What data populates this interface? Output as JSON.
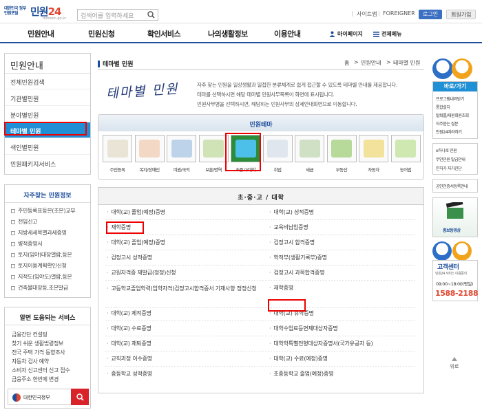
{
  "header": {
    "emblem_text": "대한민국 정부민원포털",
    "logo_main": "민원",
    "logo_num": "24",
    "logo_sub": "minwon.go.kr",
    "search_placeholder": "검색어를 입력하세요",
    "util_links": [
      "사이트맵",
      "FOREIGNER"
    ],
    "login_label": "로그인",
    "join_label": "회원가입"
  },
  "gnb": {
    "items": [
      "민원안내",
      "민원신청",
      "확인서비스",
      "나의생활정보",
      "이용안내"
    ],
    "mypage": "마이페이지",
    "all_menu": "전체메뉴"
  },
  "sidebar": {
    "title": "민원안내",
    "items": [
      "전체민원검색",
      "기관별민원",
      "분야별민원",
      "테마별 민원",
      "색인별민원",
      "민원패키지서비스"
    ],
    "active_index": 3
  },
  "frequent": {
    "title": "자주찾는 민원정보",
    "items": [
      "주민등록표등본(초본)교부",
      "전입신고",
      "지방세세목별과세증명",
      "병적증명서",
      "토지(임야)대장열람,등본",
      "토지이용계획확인신청",
      "지적도(임야도)열람,등본",
      "건축물대장등,초본발급"
    ]
  },
  "helpful": {
    "title": "알면 도움되는 서비스",
    "items": [
      "금융간단 컨설팅",
      "찾기 쉬운 생활법령정보",
      "전국 주택 가격 동향조사",
      "자동차 검사 예약",
      "소비자 신고센터 신고 접수",
      "금융주소 한번에 변경"
    ],
    "gov_label": "대한민국정부"
  },
  "main": {
    "page_title": "테마별 민원",
    "breadcrumb": [
      "홈",
      "민원안내",
      "테마별 민원"
    ],
    "calligraphy": "테마별 민원",
    "intro": [
      "자주 찾는 민원을 일상생활과 밀접한 분류체계로 쉽게 접근할 수 있도록 테마별 안내를 제공합니다.",
      "테마를 선택하시면 해당 테마별 민원사무목록이 화면에 표시됩니다.",
      "민원사무명을 선택하시면, 해당하는 민원사무의 상세안내화면으로 이동합니다."
    ]
  },
  "themes": {
    "title": "민원테마",
    "items": [
      {
        "label": "주민등록",
        "icon": "id-card-icon"
      },
      {
        "label": "복지/장애인",
        "icon": "welfare-icon"
      },
      {
        "label": "여권/국적",
        "icon": "globe-icon"
      },
      {
        "label": "보훈/병역",
        "icon": "soldier-icon"
      },
      {
        "label": "초중고/대학",
        "icon": "graduation-cap-icon"
      },
      {
        "label": "취업",
        "icon": "laptop-icon"
      },
      {
        "label": "세금",
        "icon": "money-icon"
      },
      {
        "label": "부동산",
        "icon": "land-icon"
      },
      {
        "label": "자동차",
        "icon": "car-icon"
      },
      {
        "label": "농어업",
        "icon": "farm-icon"
      }
    ],
    "selected_index": 4
  },
  "category": {
    "title": "초·중·고 / 대학",
    "left": [
      "대학(교) 졸업(예정)증명",
      "재학증명",
      "대학(교) 졸업(예정)증명",
      "검정고시 성적증명",
      "교원자격증 재발급(정정)신청",
      "고등학교졸업학력(입학자격)검정고시합격증서 기재사항 정정신청",
      "대학(교) 제적증명",
      "대학(교) 수료증명",
      "대학(교) 재퇴증명",
      "교직과정 이수증명",
      "중등학교 성적증명"
    ],
    "right": [
      "대학(교) 성적증명",
      "교육비납입증명",
      "검정고시 합격증명",
      "학적부(생활기록부)증명",
      "검정고시 과목합격증명",
      "재학증명",
      "대학(교) 휴학증명",
      "대학수업료등면제대상자증명",
      "대학학특별전형대상자증명서(국가유공자 등)",
      "대학(교) 수료(예정)증명",
      "초중등학교 졸업(예정)증명"
    ]
  },
  "rail": {
    "quick_title": "바로/가기",
    "quick_links": [
      "프로그램내려받기",
      "통합설치",
      "탈퇴를/재원회원조회",
      "자주묻는 질문",
      "민원24따라하기"
    ],
    "links2": [
      "e하나로 민원",
      "무인민원 발급안내",
      "인허가 자가진단"
    ],
    "link3": "공인인증서등록안내",
    "promo": "홍보동영상",
    "center_title": "고객센터",
    "center_sub": "민원24 서비스 이용문의",
    "hours": "09:00~18:00(평일)",
    "phone": "1588-2188",
    "top_label": "위로"
  }
}
